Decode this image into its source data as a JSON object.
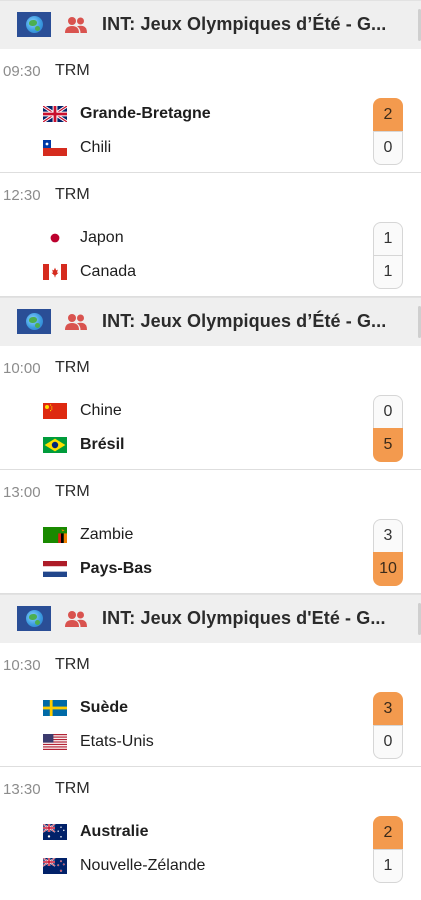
{
  "sections": [
    {
      "title": "INT:  Jeux Olympiques d’Été - G...",
      "icons": [
        "globe-flag-icon",
        "women-team-icon"
      ],
      "matches": [
        {
          "time": "09:30",
          "stage": "TRM",
          "home": {
            "name": "Grande-Bretagne",
            "flag": "gb",
            "score": "2",
            "winner": true
          },
          "away": {
            "name": "Chili",
            "flag": "cl",
            "score": "0",
            "winner": false
          }
        },
        {
          "time": "12:30",
          "stage": "TRM",
          "home": {
            "name": "Japon",
            "flag": "jp",
            "score": "1",
            "winner": false
          },
          "away": {
            "name": "Canada",
            "flag": "ca",
            "score": "1",
            "winner": false
          }
        }
      ]
    },
    {
      "title": "INT:  Jeux Olympiques d’Été - G...",
      "icons": [
        "globe-flag-icon",
        "women-team-icon"
      ],
      "matches": [
        {
          "time": "10:00",
          "stage": "TRM",
          "home": {
            "name": "Chine",
            "flag": "cn",
            "score": "0",
            "winner": false
          },
          "away": {
            "name": "Brésil",
            "flag": "br",
            "score": "5",
            "winner": true
          }
        },
        {
          "time": "13:00",
          "stage": "TRM",
          "home": {
            "name": "Zambie",
            "flag": "zm",
            "score": "3",
            "winner": false
          },
          "away": {
            "name": "Pays-Bas",
            "flag": "nl",
            "score": "10",
            "winner": true
          }
        }
      ]
    },
    {
      "title": "INT:  Jeux Olympiques d'Eté - G...",
      "icons": [
        "globe-flag-icon",
        "women-team-icon"
      ],
      "matches": [
        {
          "time": "10:30",
          "stage": "TRM",
          "home": {
            "name": "Suède",
            "flag": "se",
            "score": "3",
            "winner": true
          },
          "away": {
            "name": "Etats-Unis",
            "flag": "us",
            "score": "0",
            "winner": false
          }
        },
        {
          "time": "13:30",
          "stage": "TRM",
          "home": {
            "name": "Australie",
            "flag": "au",
            "score": "2",
            "winner": true
          },
          "away": {
            "name": "Nouvelle-Zélande",
            "flag": "nz",
            "score": "1",
            "winner": false
          }
        }
      ]
    }
  ],
  "colors": {
    "winner_score": "#f39a4e",
    "header_bg": "#efefef",
    "team_icon": "#d9534f",
    "globe_bg": "#2a4e96"
  }
}
